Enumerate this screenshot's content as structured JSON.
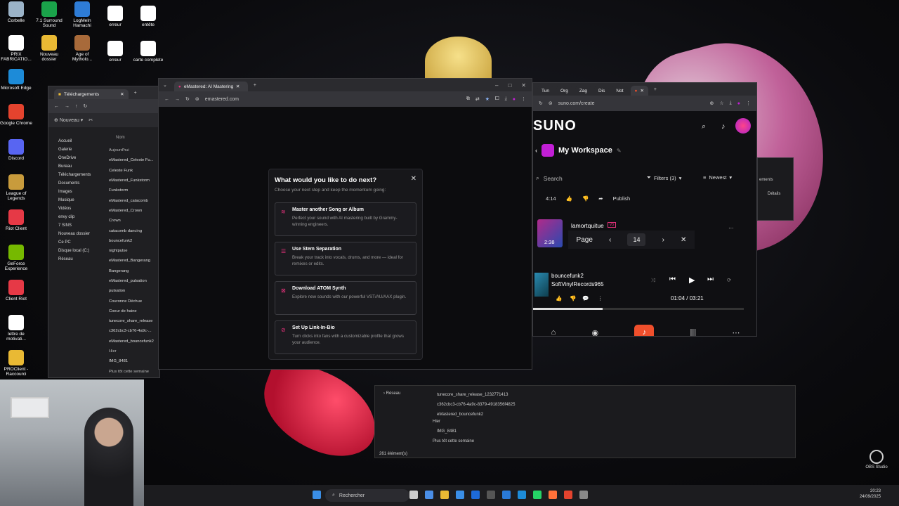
{
  "desktop_icons": [
    {
      "label": "Corbelle",
      "color": "#9bb3c8"
    },
    {
      "label": "7.1 Surround Sound",
      "color": "#1aa34a"
    },
    {
      "label": "LogMeIn Hamachi",
      "color": "#2e7cd6"
    },
    {
      "label": "erreur",
      "color": "#ffffff"
    },
    {
      "label": "entête",
      "color": "#ffffff"
    },
    {
      "label": "PRIX FABRICATIO...",
      "color": "#ffffff"
    },
    {
      "label": "Nouveau dossier",
      "color": "#e9b934"
    },
    {
      "label": "Age of Mytholo...",
      "color": "#a86a3a"
    },
    {
      "label": "erreur",
      "color": "#ffffff"
    },
    {
      "label": "carte complete",
      "color": "#ffffff"
    },
    {
      "label": "Microsoft Edge",
      "color": "#1d8bd8"
    },
    {
      "label": "Google Chrome",
      "color": "#e4432e"
    },
    {
      "label": "Discord",
      "color": "#5865f2"
    },
    {
      "label": "League of Legends",
      "color": "#c89b3c"
    },
    {
      "label": "Riot Client",
      "color": "#e63946"
    },
    {
      "label": "GeForce Experience",
      "color": "#76b900"
    },
    {
      "label": "Client Riot",
      "color": "#e63946"
    },
    {
      "label": "lettre de motivati...",
      "color": "#ffffff"
    },
    {
      "label": "PROClient - Raccourci",
      "color": "#e9b934"
    }
  ],
  "explorer": {
    "title": "Téléchargements",
    "new_button": "Nouveau",
    "column_name": "Nom",
    "group_today": "Aujourd'hui",
    "nav": [
      "Accueil",
      "Galerie",
      "OneDrive",
      "Bureau",
      "Téléchargements",
      "Documents",
      "Images",
      "Musique",
      "Vidéos",
      "envy clip",
      "7 SINS",
      "Nouveau dossier",
      "Ce PC",
      "Disque local (C:)",
      "Réseau"
    ],
    "files": [
      "eMastered_Celeste Fu...",
      "Celeste Funk",
      "eMastered_Funkstorm",
      "Funkstorm",
      "eMastered_catacomb",
      "eMastered_Crown",
      "Crown",
      "catacomb dancing",
      "bouncefunk2",
      "nightpulse",
      "eMastered_Bangerang",
      "Bangerang",
      "eMastered_pulsation",
      "pulsation",
      "Couronne Déchue",
      "Coeur de haine",
      "tunecore_share_release",
      "c362cbc3-cb76-4a9c-...",
      "eMastered_bouncefunk2"
    ],
    "group_yesterday": "Hier",
    "file_yesterday": "IMG_8481",
    "group_week": "Plus tôt cette semaine"
  },
  "emastered": {
    "tab_title": "eMastered: AI Mastering &",
    "url": "emastered.com",
    "modal": {
      "title": "What would you like to do next?",
      "subtitle": "Choose your next step and keep the momentum going:",
      "options": [
        {
          "title": "Master another Song or Album",
          "desc": "Perfect your sound with AI mastering built by Grammy-winning engineers.",
          "icon": "waveform-icon"
        },
        {
          "title": "Use Stem Separation",
          "desc": "Break your track into vocals, drums, and more — ideal for remixes or edits.",
          "icon": "layers-icon"
        },
        {
          "title": "Download ATOM Synth",
          "desc": "Explore new sounds with our powerful VST/AU/AAX plugin.",
          "icon": "synth-icon"
        },
        {
          "title": "Set Up Link-In-Bio",
          "desc": "Turn clicks into fans with a customizable profile that grows your audience.",
          "icon": "link-icon"
        }
      ]
    }
  },
  "suno": {
    "tabs": [
      "Tun",
      "Org",
      "Zag",
      "Dis",
      "Not"
    ],
    "url": "suno.com/create",
    "brand": "SUNO",
    "workspace": "My Workspace",
    "search_placeholder": "Search",
    "filters": "Filters (3)",
    "sort": "Newest",
    "row1_time": "4:14",
    "row1_publish": "Publish",
    "row2_title": "lamortquitue",
    "row2_badge": "v5",
    "row2_time": "2:38",
    "pager": {
      "label": "Page",
      "value": "14"
    },
    "now_playing": {
      "title": "bouncefunk2",
      "artist": "SoftVinylRecords965",
      "elapsed": "01:04",
      "separator": "/",
      "total": "03:21",
      "progress": 0.33
    },
    "side_panel": {
      "tab": "ements",
      "details": "Détails"
    }
  },
  "explorer2": {
    "files": [
      "tunecore_share_release_1232771413",
      "c362cbc3-cb76-4a9c-8379-4918356f4825",
      "eMastered_bouncefunk2"
    ],
    "group_yesterday": "Hier",
    "file_yesterday": "IMG_8481",
    "group_week": "Plus tôt cette semaine",
    "nav_network": "Réseau",
    "count": "261 élément(s)"
  },
  "taskbar": {
    "search": "Rechercher",
    "time": "20:23",
    "date": "24/09/2025",
    "obs_label": "OBS Studio"
  }
}
